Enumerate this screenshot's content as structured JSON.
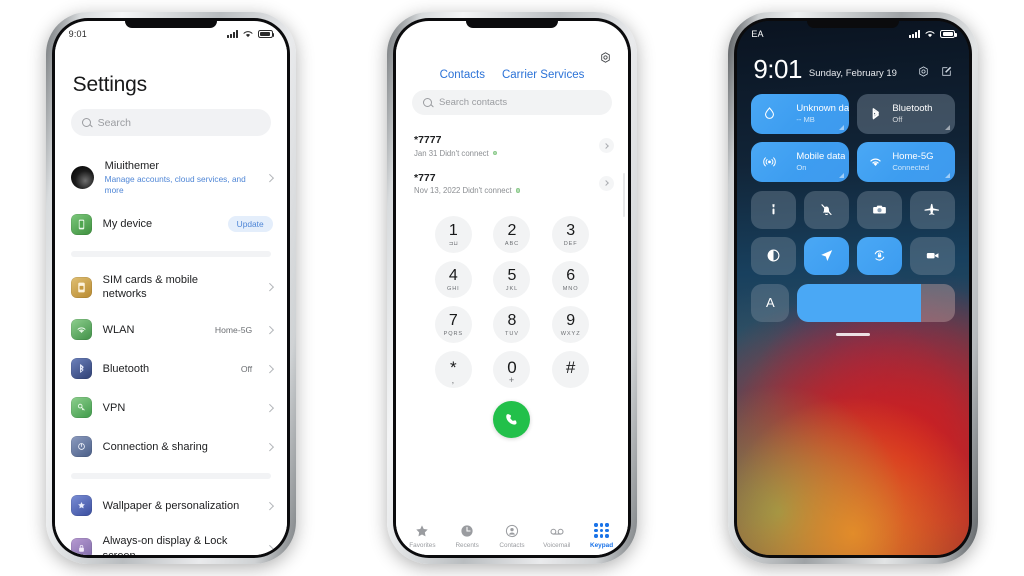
{
  "phone_settings": {
    "statusbar": {
      "time": "9:01"
    },
    "title": "Settings",
    "search_placeholder": "Search",
    "account": {
      "name": "Miuithemer",
      "subtitle": "Manage accounts, cloud services, and more"
    },
    "device": {
      "label": "My device",
      "badge": "Update"
    },
    "group_network": [
      {
        "label": "SIM cards & mobile networks",
        "value": "",
        "icon": "sim-card-icon",
        "color": "#c89a3c"
      },
      {
        "label": "WLAN",
        "value": "Home-5G",
        "icon": "wifi-icon",
        "color": "#4f9a4f"
      },
      {
        "label": "Bluetooth",
        "value": "Off",
        "icon": "bluetooth-icon",
        "color": "#3a4f8a"
      },
      {
        "label": "VPN",
        "value": "",
        "icon": "vpn-key-icon",
        "color": "#4f9a4f"
      },
      {
        "label": "Connection & sharing",
        "value": "",
        "icon": "connection-sharing-icon",
        "color": "#5c6f92"
      }
    ],
    "group_display": [
      {
        "label": "Wallpaper & personalization",
        "value": "",
        "icon": "wallpaper-icon",
        "color": "#4a62a8"
      },
      {
        "label": "Always-on display & Lock screen",
        "value": "",
        "icon": "lock-screen-icon",
        "color": "#9a7fb5"
      }
    ]
  },
  "phone_dialer": {
    "tabs": [
      {
        "label": "Contacts"
      },
      {
        "label": "Carrier Services"
      }
    ],
    "search_placeholder": "Search contacts",
    "calls": [
      {
        "number": "*7777",
        "meta": "Jan 31 Didn't connect"
      },
      {
        "number": "*777",
        "meta": "Nov 13, 2022 Didn't connect"
      }
    ],
    "keys": [
      {
        "num": "1",
        "sub": "⊐⊔"
      },
      {
        "num": "2",
        "sub": "ABC"
      },
      {
        "num": "3",
        "sub": "DEF"
      },
      {
        "num": "4",
        "sub": "GHI"
      },
      {
        "num": "5",
        "sub": "JKL"
      },
      {
        "num": "6",
        "sub": "MNO"
      },
      {
        "num": "7",
        "sub": "PQRS"
      },
      {
        "num": "8",
        "sub": "TUV"
      },
      {
        "num": "9",
        "sub": "WXYZ"
      },
      {
        "num": "*",
        "sub": ","
      },
      {
        "num": "0",
        "sub": "+"
      },
      {
        "num": "#",
        "sub": ""
      }
    ],
    "nav": [
      {
        "label": "Favorites",
        "icon": "star-icon",
        "active": false
      },
      {
        "label": "Recents",
        "icon": "clock-icon",
        "active": false
      },
      {
        "label": "Contacts",
        "icon": "person-circle-icon",
        "active": false
      },
      {
        "label": "Voicemail",
        "icon": "voicemail-icon",
        "active": false
      },
      {
        "label": "Keypad",
        "icon": "keypad-icon",
        "active": true
      }
    ],
    "call_button": "call-button",
    "accent": "#1a73e8",
    "call_green": "#22c04a"
  },
  "phone_control_center": {
    "statusbar": {
      "carrier": "EA"
    },
    "time": "9:01",
    "date": "Sunday, February 19",
    "header_icons": [
      "settings-gear-icon",
      "edit-icon"
    ],
    "tiles": [
      {
        "label": "Unknown data plan",
        "sub": "-- MB",
        "icon": "data-usage-icon",
        "state": "on"
      },
      {
        "label": "Bluetooth",
        "sub": "Off",
        "icon": "bluetooth-icon",
        "state": "off"
      },
      {
        "label": "Mobile data",
        "sub": "On",
        "icon": "mobile-data-icon",
        "state": "on"
      },
      {
        "label": "Home-5G",
        "sub": "Connected",
        "icon": "wifi-icon",
        "state": "on"
      }
    ],
    "quick_icons": [
      {
        "icon": "flashlight-icon",
        "active": false
      },
      {
        "icon": "mute-bell-icon",
        "active": false
      },
      {
        "icon": "camera-icon",
        "active": false
      },
      {
        "icon": "airplane-mode-icon",
        "active": false
      },
      {
        "icon": "dark-mode-icon",
        "active": false
      },
      {
        "icon": "location-icon",
        "active": true
      },
      {
        "icon": "rotation-lock-icon",
        "active": true
      },
      {
        "icon": "screen-record-icon",
        "active": false
      }
    ],
    "brightness": {
      "auto_label": "A",
      "percent": 78
    },
    "accent": "#4aa8f5"
  }
}
